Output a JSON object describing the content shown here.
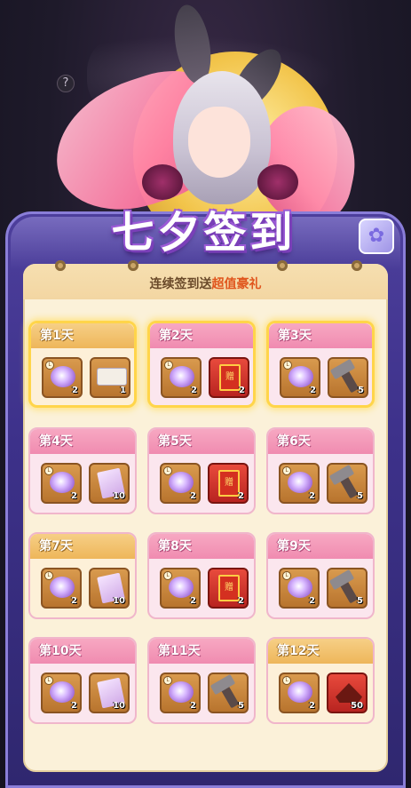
{
  "background": {
    "help_label": "?"
  },
  "banner": {
    "title": "七夕签到",
    "corner_icon": "flower-badge-icon"
  },
  "header": {
    "subtitle_prefix": "连续签到送",
    "subtitle_highlight": "超值豪礼"
  },
  "colors": {
    "frame": "#3d318a",
    "paper": "#fbf1d9",
    "highlight": "#e0561e",
    "card_header": "#f08bb0",
    "claimed_header": "#eeb65a",
    "gold_glow": "#ffd54a"
  },
  "days": [
    {
      "label": "第1天",
      "style": "claimed-gold",
      "items": [
        {
          "icon": "morning-glory-icon",
          "count": "2"
        },
        {
          "icon": "scroll-icon",
          "count": "1"
        }
      ]
    },
    {
      "label": "第2天",
      "style": "gold",
      "items": [
        {
          "icon": "morning-glory-icon",
          "count": "2"
        },
        {
          "icon": "red-book-icon",
          "count": "2"
        }
      ]
    },
    {
      "label": "第3天",
      "style": "gold",
      "items": [
        {
          "icon": "morning-glory-icon",
          "count": "2"
        },
        {
          "icon": "hammer-icon",
          "count": "5"
        }
      ]
    },
    {
      "label": "第4天",
      "style": "normal",
      "items": [
        {
          "icon": "morning-glory-icon",
          "count": "2"
        },
        {
          "icon": "letter-icon",
          "count": "10"
        }
      ]
    },
    {
      "label": "第5天",
      "style": "normal",
      "items": [
        {
          "icon": "morning-glory-icon",
          "count": "2"
        },
        {
          "icon": "red-book-icon",
          "count": "2"
        }
      ]
    },
    {
      "label": "第6天",
      "style": "normal",
      "items": [
        {
          "icon": "morning-glory-icon",
          "count": "2"
        },
        {
          "icon": "hammer-icon",
          "count": "5"
        }
      ]
    },
    {
      "label": "第7天",
      "style": "claimed",
      "items": [
        {
          "icon": "morning-glory-icon",
          "count": "2"
        },
        {
          "icon": "letter-icon",
          "count": "10"
        }
      ]
    },
    {
      "label": "第8天",
      "style": "normal",
      "items": [
        {
          "icon": "morning-glory-icon",
          "count": "2"
        },
        {
          "icon": "red-book-icon",
          "count": "2"
        }
      ]
    },
    {
      "label": "第9天",
      "style": "normal",
      "items": [
        {
          "icon": "morning-glory-icon",
          "count": "2"
        },
        {
          "icon": "hammer-icon",
          "count": "5"
        }
      ]
    },
    {
      "label": "第10天",
      "style": "normal",
      "items": [
        {
          "icon": "morning-glory-icon",
          "count": "2"
        },
        {
          "icon": "letter-icon",
          "count": "10"
        }
      ]
    },
    {
      "label": "第11天",
      "style": "normal",
      "items": [
        {
          "icon": "morning-glory-icon",
          "count": "2"
        },
        {
          "icon": "hammer-icon",
          "count": "5"
        }
      ]
    },
    {
      "label": "第12天",
      "style": "claimed",
      "items": [
        {
          "icon": "morning-glory-icon",
          "count": "2"
        },
        {
          "icon": "red-hat-icon",
          "count": "50"
        }
      ]
    }
  ]
}
